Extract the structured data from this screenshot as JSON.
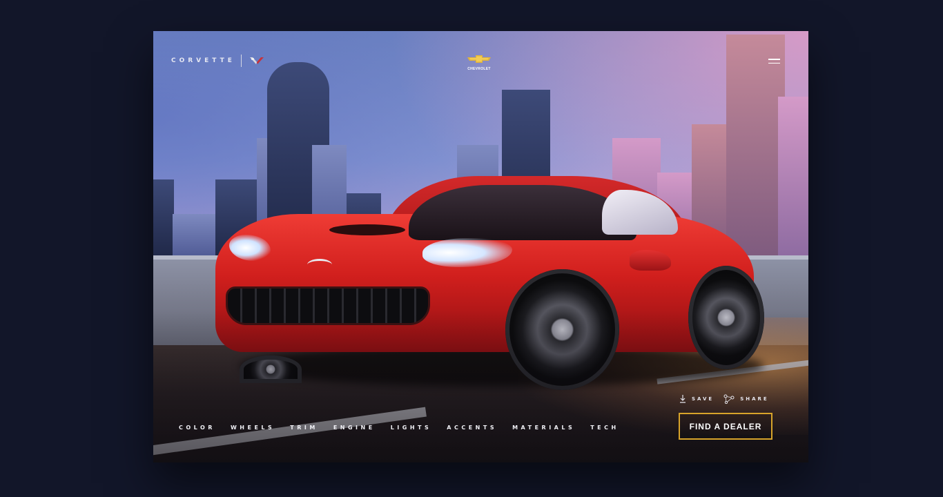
{
  "brand": {
    "name": "CORVETTE",
    "logo_icon": "corvette-flags-icon"
  },
  "header": {
    "center_logo_icon": "chevrolet-bowtie-icon",
    "center_logo_text": "CHEVROLET",
    "menu_icon": "hamburger-menu-icon"
  },
  "actions": {
    "save_label": "SAVE",
    "save_icon": "download-arrow-icon",
    "share_label": "SHARE",
    "share_icon": "share-nodes-icon"
  },
  "nav": {
    "items": [
      "COLOR",
      "WHEELS",
      "TRIM",
      "ENGINE",
      "LIGHTS",
      "ACCENTS",
      "MATERIALS",
      "TECH"
    ]
  },
  "cta": {
    "find_dealer_label": "FIND A DEALER"
  },
  "colors": {
    "page_background": "#121629",
    "car_red": "#d11f1d",
    "button_border_gold": "#d8a42a",
    "logo_gold": "#e1b43b"
  }
}
